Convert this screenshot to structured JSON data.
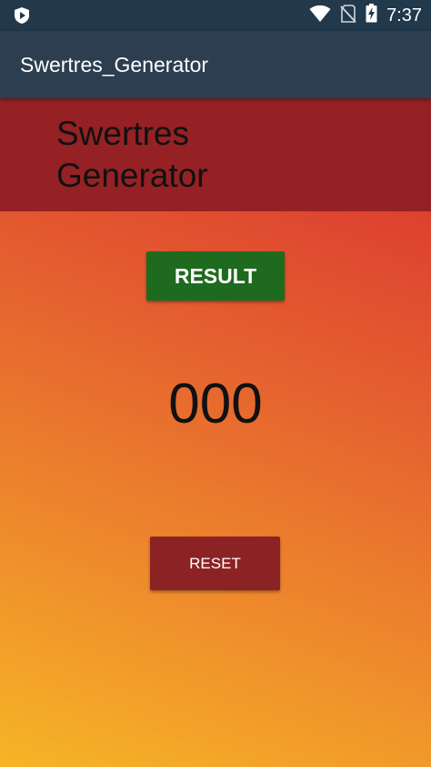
{
  "status_bar": {
    "time": "7:37",
    "icons": [
      "app-shield-icon",
      "wifi-icon",
      "no-sim-icon",
      "battery-charging-icon"
    ]
  },
  "app_bar": {
    "title": "Swertres_Generator"
  },
  "header": {
    "title": "Swertres Generator"
  },
  "result_button": {
    "label": "RESULT"
  },
  "result": {
    "value": "000"
  },
  "reset_button": {
    "label": "RESET"
  },
  "colors": {
    "status_bar": "#22384b",
    "app_bar": "#2c3e50",
    "header_band": "#952124",
    "result_button": "#1e6a1e",
    "reset_button": "#8b2325",
    "gradient_top": "#d92f30",
    "gradient_bottom": "#f6b526"
  }
}
